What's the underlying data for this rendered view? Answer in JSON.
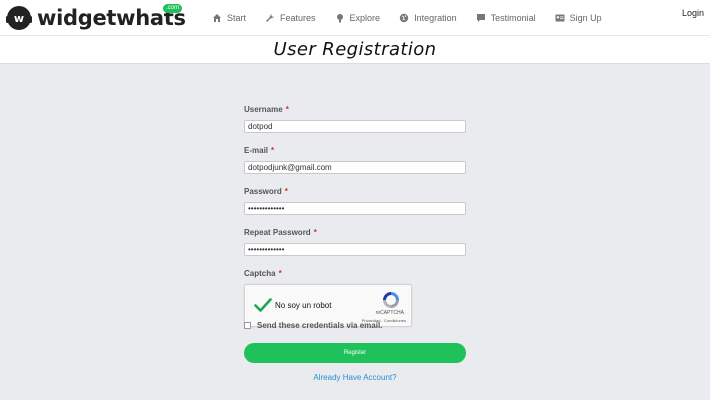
{
  "brand": {
    "name": "widgetwhats",
    "badge": ".com",
    "accent": "#1ec15a"
  },
  "nav": {
    "items": [
      {
        "label": "Start",
        "icon": "home-icon"
      },
      {
        "label": "Features",
        "icon": "wrench-icon"
      },
      {
        "label": "Explore",
        "icon": "lightbulb-icon"
      },
      {
        "label": "Integration",
        "icon": "globe-icon"
      },
      {
        "label": "Testimonial",
        "icon": "chat-icon"
      },
      {
        "label": "Sign Up",
        "icon": "id-card-icon"
      }
    ],
    "login_label": "Login"
  },
  "page": {
    "title": "User Registration"
  },
  "form": {
    "username": {
      "label": "Username",
      "required_mark": "*",
      "value": "dotpod"
    },
    "email": {
      "label": "E-mail",
      "required_mark": "*",
      "value": "dotpodjunk@gmail.com"
    },
    "password": {
      "label": "Password",
      "required_mark": "*",
      "value": "•••••••••••••"
    },
    "repeat_password": {
      "label": "Repeat Password",
      "required_mark": "*",
      "value": "•••••••••••••"
    },
    "captcha": {
      "label": "Captcha",
      "required_mark": "*",
      "checkbox_text": "No soy un robot",
      "brand": "reCAPTCHA",
      "terms": "Privacidad - Condiciones",
      "checked": true
    },
    "send_credentials_label": "Send these credentials via email.",
    "register_label": "Register",
    "already_account_link": "Already Have Account?"
  }
}
